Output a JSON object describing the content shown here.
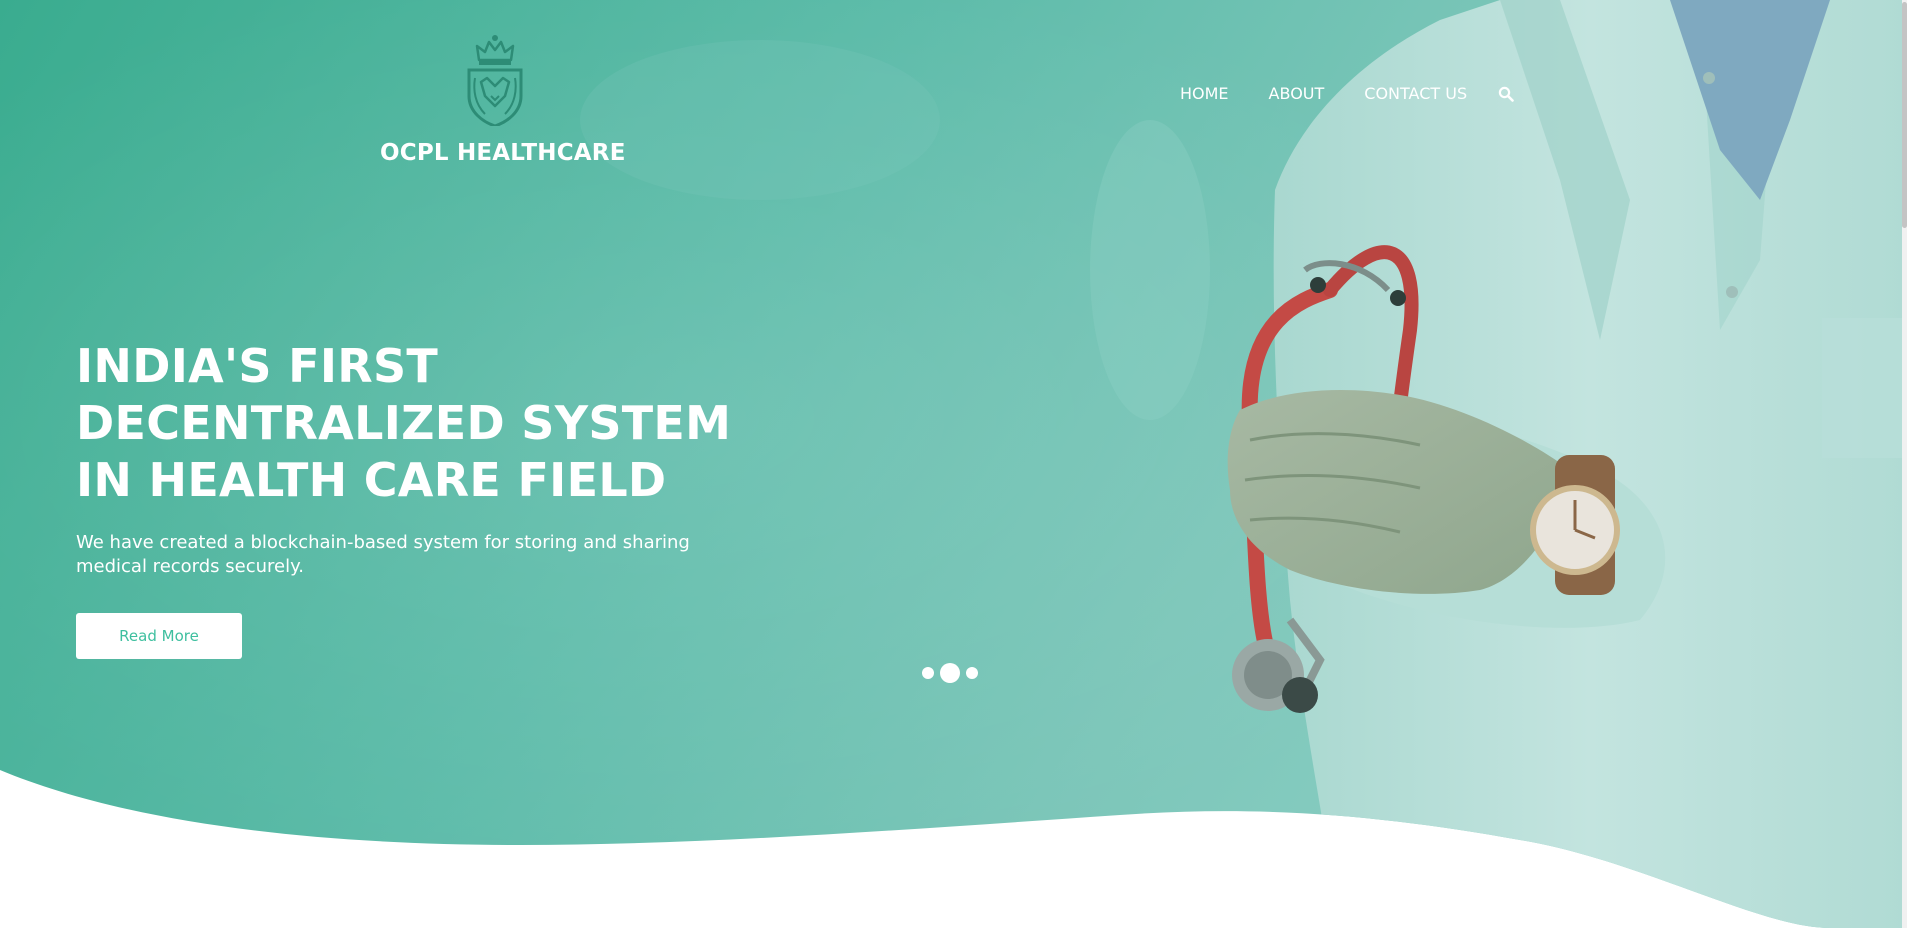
{
  "brand": {
    "name": "OCPL HEALTHCARE",
    "emblem_icon": "crowned-lion-shield-icon"
  },
  "nav": {
    "items": [
      {
        "label": "HOME"
      },
      {
        "label": "ABOUT"
      },
      {
        "label": "CONTACT US"
      }
    ],
    "search_icon": "search-icon"
  },
  "hero": {
    "headline_lines": [
      "INDIA'S FIRST",
      "DECENTRALIZED SYSTEM",
      "IN HEALTH CARE FIELD"
    ],
    "subtext": "We have created a blockchain-based system for storing and sharing medical records securely.",
    "cta_label": "Read More",
    "image": "doctor-with-stethoscope-and-watch"
  },
  "slider": {
    "dot_count": 3,
    "active_index": 1
  },
  "colors": {
    "teal": "#5cbcab",
    "teal_dark": "#3aa38c",
    "cta_text": "#3ebf9f",
    "white": "#ffffff"
  }
}
